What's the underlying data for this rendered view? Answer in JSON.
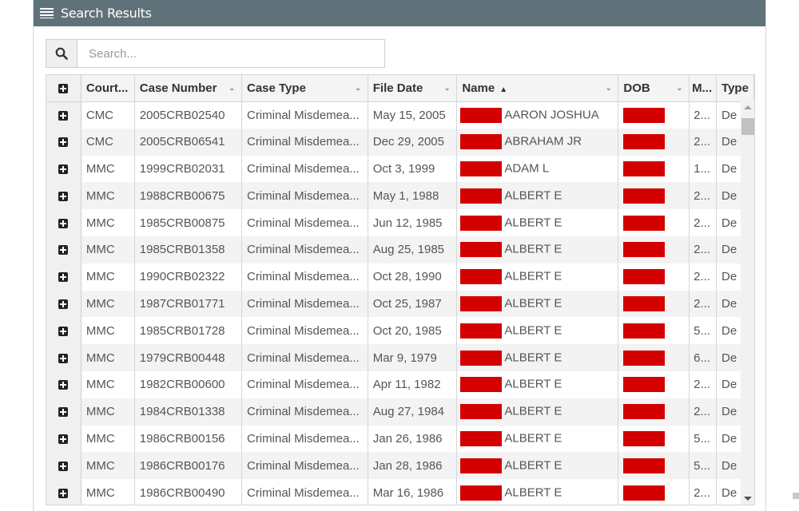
{
  "panel": {
    "title": "Search Results",
    "title_icon": "list-icon"
  },
  "search": {
    "placeholder": "Search...",
    "value": "",
    "icon": "search-icon"
  },
  "grid": {
    "columns": [
      {
        "key": "expander",
        "label": "",
        "icon": "plus-square-icon"
      },
      {
        "key": "court",
        "label": "Court...",
        "menu": true
      },
      {
        "key": "case_number",
        "label": "Case Number",
        "menu": true
      },
      {
        "key": "case_type",
        "label": "Case Type",
        "menu": true
      },
      {
        "key": "file_date",
        "label": "File Date",
        "menu": true
      },
      {
        "key": "name",
        "label": "Name",
        "menu": true,
        "sort": "ascending"
      },
      {
        "key": "dob",
        "label": "DOB",
        "menu": true
      },
      {
        "key": "m",
        "label": "M...",
        "menu": false
      },
      {
        "key": "type",
        "label": "Type",
        "menu": false
      }
    ],
    "redaction_color": "#d40000",
    "rows": [
      {
        "court": "CMC",
        "case_number": "2005CRB02540",
        "case_type": "Criminal Misdemea...",
        "file_date": "May 15, 2005",
        "name": "AARON JOSHUA",
        "m": "2...",
        "type": "De"
      },
      {
        "court": "CMC",
        "case_number": "2005CRB06541",
        "case_type": "Criminal Misdemea...",
        "file_date": "Dec 29, 2005",
        "name": "ABRAHAM JR",
        "m": "2...",
        "type": "De"
      },
      {
        "court": "MMC",
        "case_number": "1999CRB02031",
        "case_type": "Criminal Misdemea...",
        "file_date": "Oct 3, 1999",
        "name": "ADAM L",
        "m": "1...",
        "type": "De"
      },
      {
        "court": "MMC",
        "case_number": "1988CRB00675",
        "case_type": "Criminal Misdemea...",
        "file_date": "May 1, 1988",
        "name": "ALBERT E",
        "m": "2...",
        "type": "De"
      },
      {
        "court": "MMC",
        "case_number": "1985CRB00875",
        "case_type": "Criminal Misdemea...",
        "file_date": "Jun 12, 1985",
        "name": "ALBERT E",
        "m": "2...",
        "type": "De"
      },
      {
        "court": "MMC",
        "case_number": "1985CRB01358",
        "case_type": "Criminal Misdemea...",
        "file_date": "Aug 25, 1985",
        "name": "ALBERT E",
        "m": "2...",
        "type": "De"
      },
      {
        "court": "MMC",
        "case_number": "1990CRB02322",
        "case_type": "Criminal Misdemea...",
        "file_date": "Oct 28, 1990",
        "name": "ALBERT E",
        "m": "2...",
        "type": "De"
      },
      {
        "court": "MMC",
        "case_number": "1987CRB01771",
        "case_type": "Criminal Misdemea...",
        "file_date": "Oct 25, 1987",
        "name": "ALBERT E",
        "m": "2...",
        "type": "De"
      },
      {
        "court": "MMC",
        "case_number": "1985CRB01728",
        "case_type": "Criminal Misdemea...",
        "file_date": "Oct 20, 1985",
        "name": "ALBERT E",
        "m": "5...",
        "type": "De"
      },
      {
        "court": "MMC",
        "case_number": "1979CRB00448",
        "case_type": "Criminal Misdemea...",
        "file_date": "Mar 9, 1979",
        "name": "ALBERT E",
        "m": "6...",
        "type": "De"
      },
      {
        "court": "MMC",
        "case_number": "1982CRB00600",
        "case_type": "Criminal Misdemea...",
        "file_date": "Apr 11, 1982",
        "name": "ALBERT E",
        "m": "2...",
        "type": "De"
      },
      {
        "court": "MMC",
        "case_number": "1984CRB01338",
        "case_type": "Criminal Misdemea...",
        "file_date": "Aug 27, 1984",
        "name": "ALBERT E",
        "m": "2...",
        "type": "De"
      },
      {
        "court": "MMC",
        "case_number": "1986CRB00156",
        "case_type": "Criminal Misdemea...",
        "file_date": "Jan 26, 1986",
        "name": "ALBERT E",
        "m": "5...",
        "type": "De"
      },
      {
        "court": "MMC",
        "case_number": "1986CRB00176",
        "case_type": "Criminal Misdemea...",
        "file_date": "Jan 28, 1986",
        "name": "ALBERT E",
        "m": "5...",
        "type": "De"
      },
      {
        "court": "MMC",
        "case_number": "1986CRB00490",
        "case_type": "Criminal Misdemea...",
        "file_date": "Mar 16, 1986",
        "name": "ALBERT E",
        "m": "2...",
        "type": "De"
      }
    ]
  }
}
